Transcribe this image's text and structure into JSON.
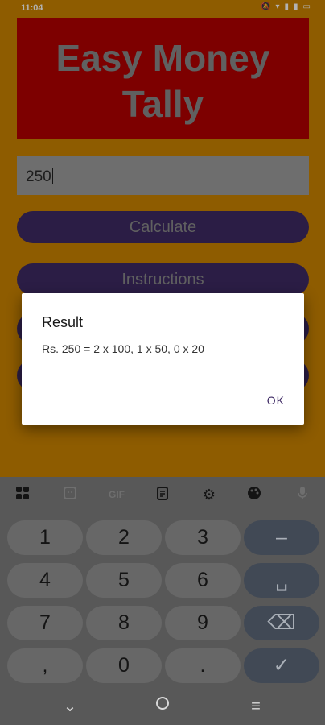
{
  "status": {
    "time": "11:04"
  },
  "app": {
    "title": "Easy Money Tally",
    "input_value": "250",
    "buttons": [
      "Calculate",
      "Instructions"
    ]
  },
  "dialog": {
    "title": "Result",
    "message": "Rs. 250 = 2 x 100, 1 x 50, 0 x 20",
    "ok_label": "OK"
  },
  "keyboard": {
    "toolbar": [
      "grid-icon",
      "sticker-icon",
      "GIF",
      "clipboard-icon",
      "gear-icon",
      "palette-icon",
      "mic-icon"
    ],
    "gif_label": "GIF",
    "rows": [
      [
        "1",
        "2",
        "3",
        "–"
      ],
      [
        "4",
        "5",
        "6",
        "␣"
      ],
      [
        "7",
        "8",
        "9",
        "⌫"
      ],
      [
        ",",
        "0",
        ".",
        "✓"
      ]
    ]
  },
  "colors": {
    "app_bg": "#cc8400",
    "banner": "#b30000",
    "button": "#3e2a64",
    "dialog": "#ffffff"
  }
}
